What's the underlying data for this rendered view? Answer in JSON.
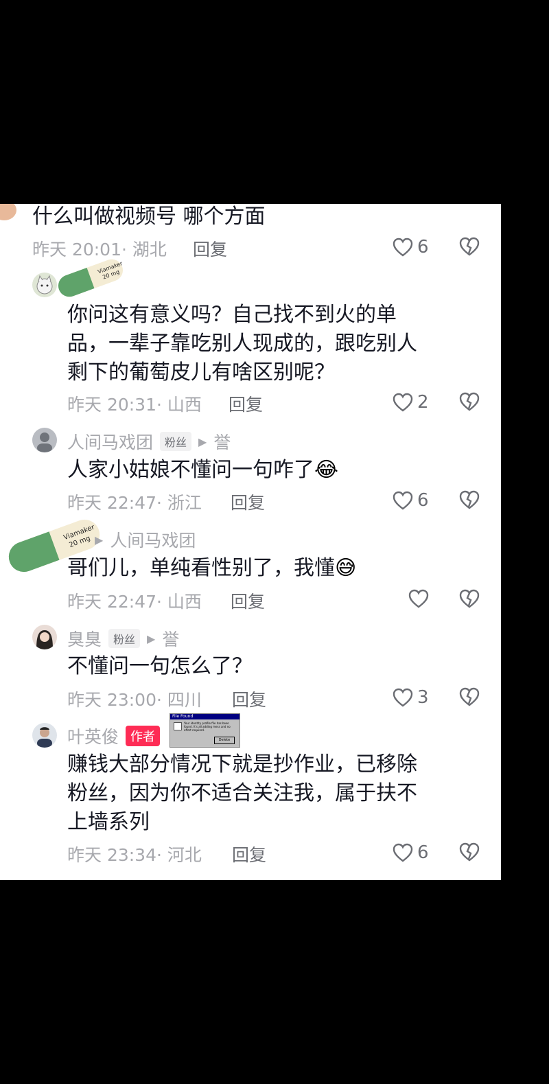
{
  "comments": [
    {
      "text": "什么叫做视频号 哪个方面",
      "meta": "昨天 20:01· 湖北",
      "reply_label": "回复",
      "likes": "6"
    },
    {
      "text_lines": [
        "你问这有意义吗？自己找不到火的单",
        "品，一辈子靠吃别人现成的，跟吃别人",
        "剩下的葡萄皮儿有啥区别呢？"
      ],
      "meta": "昨天 20:31· 山西",
      "reply_label": "回复",
      "likes": "2"
    },
    {
      "username": "人间马戏团",
      "badge": "粉丝",
      "reply_to": "誉",
      "text": "人家小姑娘不懂问一句咋了",
      "meta": "昨天 22:47· 浙江",
      "reply_label": "回复",
      "likes": "6"
    },
    {
      "reply_to": "人间马戏团",
      "text": "哥们儿，单纯看性别了，我懂",
      "meta": "昨天 22:47· 山西",
      "reply_label": "回复",
      "likes": ""
    },
    {
      "username": "臭臭",
      "badge": "粉丝",
      "reply_to": "誉",
      "text": "不懂问一句怎么了？",
      "meta": "昨天 23:00· 四川",
      "reply_label": "回复",
      "likes": "3"
    },
    {
      "username": "叶英俊",
      "badge": "作者",
      "text_lines": [
        "赚钱大部分情况下就是抄作业，已移除",
        "粉丝，因为你不适合关注我，属于扶不",
        "上墙系列"
      ],
      "meta": "昨天 23:34· 河北",
      "reply_label": "回复",
      "likes": "6"
    }
  ],
  "pill_label": [
    "Viamaker",
    "20 mg"
  ],
  "dialog": {
    "title": "File Found",
    "message": "Your identity profile file has been found. It's all adding mess and no effort required.",
    "button": "Delete"
  },
  "colors": {
    "author_badge": "#fe2c55",
    "meta": "#a7a8ad",
    "text": "#161823"
  }
}
